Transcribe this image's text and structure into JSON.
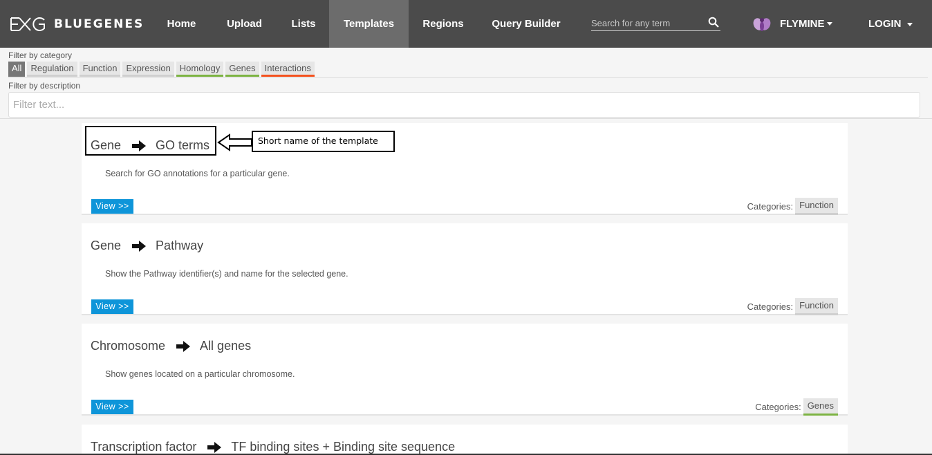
{
  "navbar": {
    "brand": "BLUEGENES",
    "items": [
      "Home",
      "Upload",
      "Lists",
      "Templates",
      "Regions",
      "Query Builder"
    ],
    "active": "Templates",
    "search_placeholder": "Search for any term",
    "mine": "FLYMINE",
    "login": "LOGIN"
  },
  "filters": {
    "category_label": "Filter by category",
    "categories": [
      "All",
      "Regulation",
      "Function",
      "Expression",
      "Homology",
      "Genes",
      "Interactions"
    ],
    "active_category": "All",
    "description_label": "Filter by description",
    "description_placeholder": "Filter text..."
  },
  "templates": [
    {
      "from": "Gene",
      "to": "GO terms",
      "description": "Search for GO annotations for a particular gene.",
      "view": "View >>",
      "categories_label": "Categories:",
      "category": "Function"
    },
    {
      "from": "Gene",
      "to": "Pathway",
      "description": "Show the Pathway identifier(s) and name for the selected gene.",
      "view": "View >>",
      "categories_label": "Categories:",
      "category": "Function"
    },
    {
      "from": "Chromosome",
      "to": "All genes",
      "description": "Show genes located on a particular chromosome.",
      "view": "View >>",
      "categories_label": "Categories:",
      "category": "Genes"
    },
    {
      "from": "Transcription factor",
      "to": "TF binding sites + Binding site sequence"
    }
  ],
  "annotation": {
    "label": "Short name of the template"
  },
  "colors": {
    "navbar": "#4b4b4b",
    "view_button": "#0e95d9",
    "genes_accent": "#7cb342",
    "interactions_accent": "#f4511e"
  }
}
